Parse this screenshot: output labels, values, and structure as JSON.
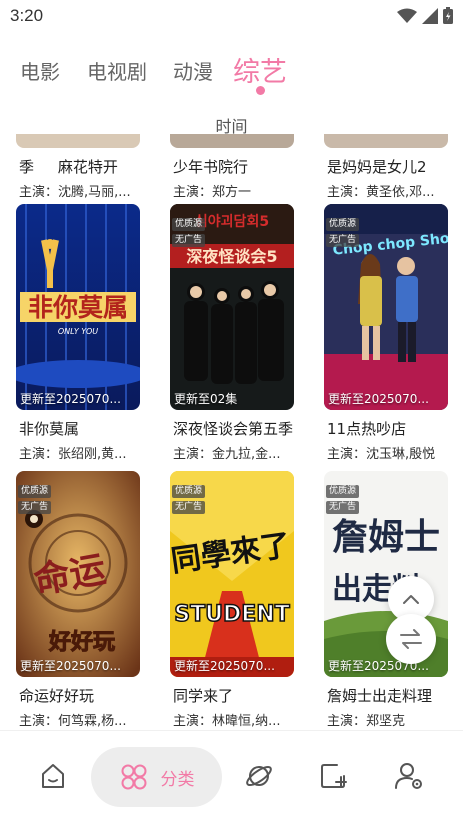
{
  "status_bar": {
    "time": "3:20"
  },
  "tabs": [
    {
      "label": "电影"
    },
    {
      "label": "电视剧"
    },
    {
      "label": "动漫"
    },
    {
      "label": "综艺"
    }
  ],
  "active_tab": "综艺",
  "sort_label": "时间",
  "badges": {
    "quality": "优质源",
    "no_ads": "无广告"
  },
  "partial_row": [
    {
      "title": "季",
      "title2": "麻花特开",
      "cast": "主演：沈腾,马丽,..."
    },
    {
      "title": "少年书院行",
      "cast": "主演：郑方一"
    },
    {
      "title": "是妈妈是女儿2",
      "cast": "主演：黄圣依,邓..."
    }
  ],
  "items": [
    {
      "title": "非你莫属",
      "cast": "主演：张绍刚,黄...",
      "update": "更新至2025070...",
      "poster_text": "非你莫属",
      "poster_sub": "ONLY YOU"
    },
    {
      "title": "深夜怪谈会第五季",
      "cast": "主演：金九拉,金...",
      "update": "更新至02集",
      "poster_text": "深夜怪谈会5",
      "poster_sub": "심야괴담회5"
    },
    {
      "title": "11点热吵店",
      "cast": "主演：沈玉琳,殷悦",
      "update": "更新至2025070...",
      "poster_text": "Chop chop Show",
      "poster_sub": ""
    },
    {
      "title": "命运好好玩",
      "cast": "主演：何笃霖,杨...",
      "update": "更新至2025070...",
      "poster_text": "命运",
      "poster_sub": "好好玩"
    },
    {
      "title": "同学来了",
      "cast": "主演：林暐恒,纳...",
      "update": "更新至2025070...",
      "poster_text": "同學來了",
      "poster_sub": "STUDENT"
    },
    {
      "title": "詹姆士出走料理",
      "cast": "主演：郑坚克",
      "update": "更新至2025070...",
      "poster_text": "詹姆士",
      "poster_sub": "出走料"
    }
  ],
  "bottom_nav": {
    "category_label": "分类"
  },
  "colors": {
    "accent": "#f27aa6",
    "text": "#222222",
    "muted": "#666666",
    "pill_bg": "#ededed"
  },
  "icons": [
    "wifi-icon",
    "signal-icon",
    "battery-icon",
    "home-icon",
    "category-icon",
    "planet-icon",
    "add-icon",
    "user-settings-icon",
    "scroll-top-icon",
    "swap-icon"
  ]
}
